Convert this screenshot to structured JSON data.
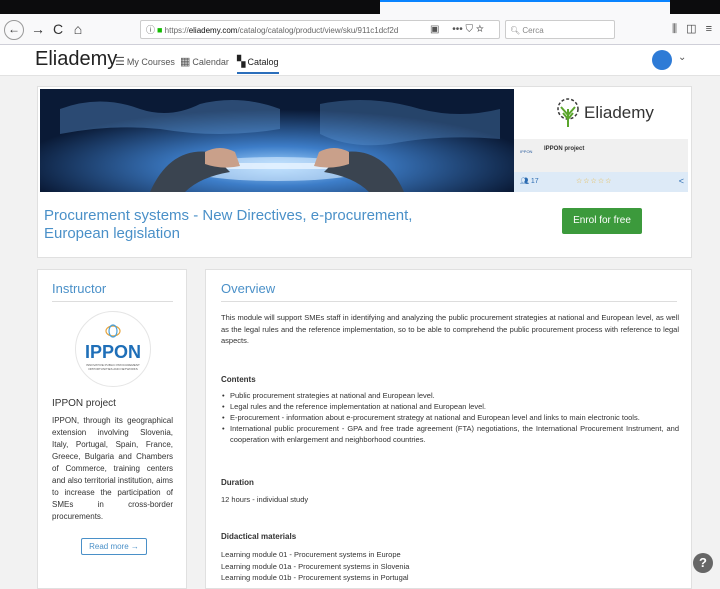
{
  "browser": {
    "url_prefix": "https://",
    "url_domain": "eliademy.com",
    "url_path": "/catalog/catalog/product/view/sku/911c1dcf2d",
    "search_placeholder": "Cerca",
    "dots": "•••"
  },
  "header": {
    "logo": "Eliademy",
    "nav": [
      {
        "label": "My Courses",
        "icon": "menu-icon"
      },
      {
        "label": "Calendar",
        "icon": "calendar-icon"
      },
      {
        "label": "Catalog",
        "icon": "grid-icon"
      }
    ]
  },
  "course": {
    "title": "Procurement systems - New Directives, e-procurement, European legislation",
    "enrol_label": "Enrol for free",
    "brand": "Eliademy",
    "project_name": "IPPON project",
    "project_thumb": "IPPON",
    "participants": "17",
    "rating_stars": "☆☆☆☆☆"
  },
  "instructor": {
    "heading": "Instructor",
    "logo_text": "IPPON",
    "logo_subtext": "INNOVATIVE PUBLIC PROCUREMENT OPPORTUNITIES AND NETWORKS",
    "name": "IPPON project",
    "bio": "IPPON, through its geographical extension involving Slovenia, Italy, Portugal, Spain, France, Greece, Bulgaria and Chambers of Commerce, training centers and also territorial institution, aims to increase the participation of SMEs in cross-border procurements.",
    "read_more": "Read more →"
  },
  "overview": {
    "heading": "Overview",
    "intro": "This module will support SMEs staff in identifying and analyzing the public procurement strategies at national and European level, as well as the legal rules and the reference implementation, so to be able to comprehend the public procurement process with reference to legal aspects.",
    "contents_heading": "Contents",
    "contents": [
      "Public procurement strategies at national and European level.",
      "Legal rules and the reference implementation at national and European level.",
      "E-procurement - information about e-procurement strategy at national and European level and links to main electronic tools.",
      "International public procurement - GPA and free trade agreement (FTA) negotiations, the International Procurement Instrument, and cooperation with enlargement and neighborhood countries."
    ],
    "duration_heading": "Duration",
    "duration": "12 hours - individual study",
    "didactic_heading": "Didactical materials",
    "didactic": [
      "Learning module 01 - Procurement systems in Europe",
      "Learning module 01a - Procurement systems in Slovenia",
      "Learning module 01b - Procurement systems in Portugal"
    ]
  },
  "help": "?"
}
